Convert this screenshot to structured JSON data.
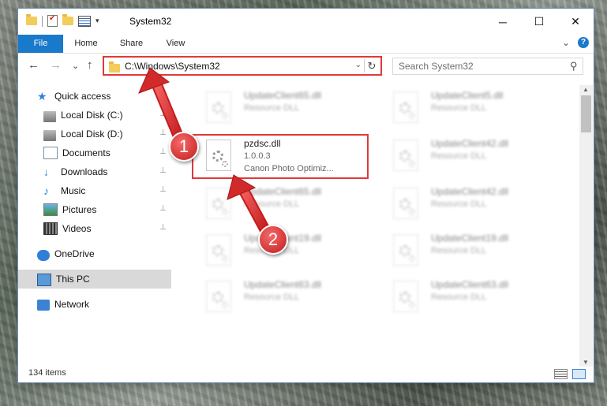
{
  "window": {
    "title": "System32",
    "minimize_glyph": "─",
    "maximize_glyph": "☐",
    "close_glyph": "✕"
  },
  "ribbon": {
    "tabs": [
      "File",
      "Home",
      "Share",
      "View"
    ],
    "collapse_glyph": "⌄",
    "help_glyph": "?"
  },
  "navigation": {
    "back_glyph": "←",
    "forward_glyph": "→",
    "recent_glyph": "⌄",
    "up_glyph": "↑",
    "address": "C:\\Windows\\System32",
    "address_dropdown_glyph": "⌄",
    "refresh_glyph": "↻",
    "search_placeholder": "Search System32",
    "search_glyph": "⚲"
  },
  "sidebar": {
    "items": [
      {
        "label": "Quick access",
        "icon": "star-icon"
      },
      {
        "label": "Local Disk (C:)",
        "icon": "drive-icon",
        "pinned": true
      },
      {
        "label": "Local Disk (D:)",
        "icon": "drive-icon",
        "pinned": true
      },
      {
        "label": "Documents",
        "icon": "documents-icon",
        "pinned": true
      },
      {
        "label": "Downloads",
        "icon": "download-icon",
        "pinned": true
      },
      {
        "label": "Music",
        "icon": "music-icon",
        "pinned": true
      },
      {
        "label": "Pictures",
        "icon": "pictures-icon",
        "pinned": true
      },
      {
        "label": "Videos",
        "icon": "videos-icon",
        "pinned": true
      },
      {
        "label": "OneDrive",
        "icon": "cloud-icon"
      },
      {
        "label": "This PC",
        "icon": "computer-icon",
        "selected": true
      },
      {
        "label": "Network",
        "icon": "network-icon"
      }
    ],
    "pin_glyph": "📌"
  },
  "files": {
    "highlighted": {
      "name": "pzdsc.dll",
      "version": "1.0.0.3",
      "description": "Canon Photo Optimiz..."
    },
    "blurred": [
      {
        "name": "UpdateClient65.dll",
        "type": "Resource DLL"
      },
      {
        "name": "UpdateClient5.dll",
        "type": "Resource DLL"
      },
      {
        "name": "UpdateClient42.dll",
        "type": "Resource DLL"
      },
      {
        "name": "UpdateClient65.dll",
        "type": "Resource DLL"
      },
      {
        "name": "UpdateClient42.dll",
        "type": "Resource DLL"
      },
      {
        "name": "UpdateClient19.dll",
        "type": "Resource DLL"
      },
      {
        "name": "UpdateClient19.dll",
        "type": "Resource DLL"
      },
      {
        "name": "UpdateClient63.dll",
        "type": "Resource DLL"
      },
      {
        "name": "UpdateClient63.dll",
        "type": "Resource DLL"
      }
    ]
  },
  "status": {
    "item_count": "134 items"
  },
  "callouts": {
    "step1": "1",
    "step2": "2"
  },
  "colors": {
    "accent": "#1979ca",
    "highlight": "#e03a3a"
  }
}
